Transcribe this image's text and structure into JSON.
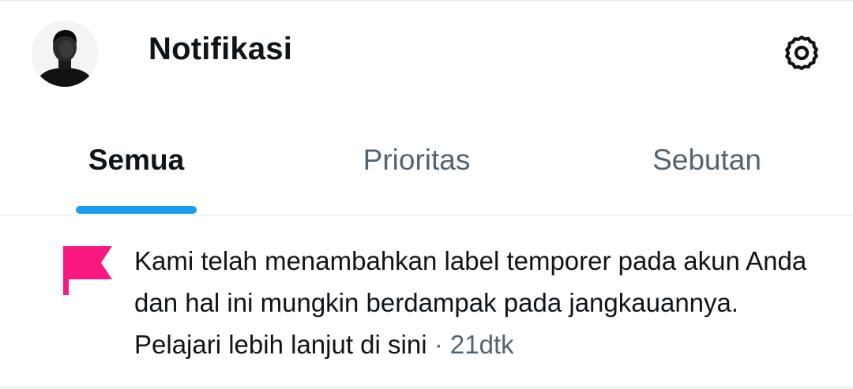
{
  "header": {
    "title": "Notifikasi",
    "avatar_icon": "avatar",
    "settings_icon": "gear-icon"
  },
  "tabs": [
    {
      "label": "Semua",
      "active": true
    },
    {
      "label": "Prioritas",
      "active": false
    },
    {
      "label": "Sebutan",
      "active": false
    }
  ],
  "notification": {
    "icon": "flag-icon",
    "icon_color": "#f91880",
    "message": "Kami telah menambahkan label temporer pada akun Anda dan hal ini mungkin berdampak pada jangkauannya. Pelajari lebih lanjut di sini",
    "separator": "·",
    "timestamp": "21dtk"
  },
  "colors": {
    "accent": "#1d9bf0",
    "text_primary": "#0f1419",
    "text_secondary": "#536471",
    "divider": "#eff3f4"
  }
}
